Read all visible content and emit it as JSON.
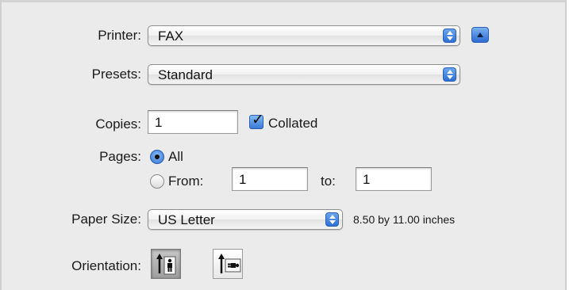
{
  "printer": {
    "label": "Printer:",
    "value": "FAX"
  },
  "presets": {
    "label": "Presets:",
    "value": "Standard"
  },
  "copies": {
    "label": "Copies:",
    "value": "1",
    "collated_label": "Collated",
    "collated_checked": true
  },
  "pages": {
    "label": "Pages:",
    "all_label": "All",
    "from_label": "From:",
    "from_value": "1",
    "to_label": "to:",
    "to_value": "1",
    "selected": "all"
  },
  "paper_size": {
    "label": "Paper Size:",
    "value": "US Letter",
    "dimensions": "8.50 by 11.00 inches"
  },
  "orientation": {
    "label": "Orientation:",
    "options": [
      "portrait",
      "landscape"
    ],
    "selected": "portrait"
  },
  "icons": {
    "popup_arrows": "up-down-arrows-icon",
    "disclosure": "disclosure-triangle-icon",
    "checkmark": "checkmark-icon",
    "portrait": "portrait-orientation-icon",
    "landscape": "landscape-orientation-icon"
  },
  "colors": {
    "accent": "#3a7ad8",
    "background": "#ebebeb"
  }
}
